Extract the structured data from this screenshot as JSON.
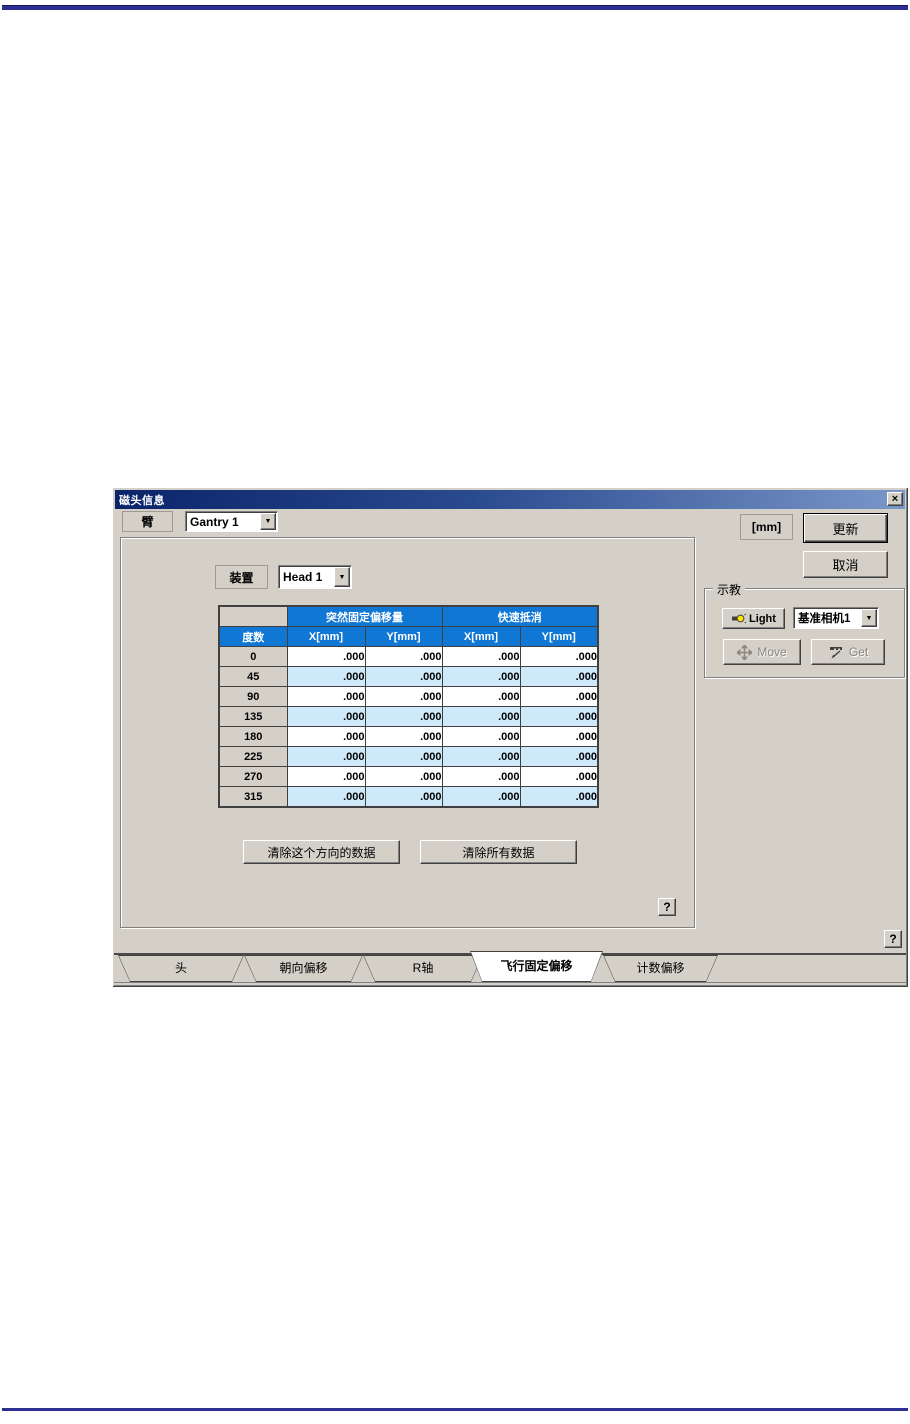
{
  "window": {
    "title": "磁头信息"
  },
  "icons": {
    "close": "×",
    "dropdown": "▼",
    "help": "?"
  },
  "arm": {
    "label": "臂",
    "value": "Gantry 1"
  },
  "toolbar": {
    "unit": "[mm]",
    "update": "更新",
    "cancel": "取消"
  },
  "device": {
    "label": "装置",
    "value": "Head 1"
  },
  "table": {
    "group_headers": [
      "突然固定偏移量",
      "快速抵消"
    ],
    "columns": [
      "度数",
      "X[mm]",
      "Y[mm]",
      "X[mm]",
      "Y[mm]"
    ],
    "rows": [
      {
        "deg": "0",
        "v": [
          ".000",
          ".000",
          ".000",
          ".000"
        ]
      },
      {
        "deg": "45",
        "v": [
          ".000",
          ".000",
          ".000",
          ".000"
        ]
      },
      {
        "deg": "90",
        "v": [
          ".000",
          ".000",
          ".000",
          ".000"
        ]
      },
      {
        "deg": "135",
        "v": [
          ".000",
          ".000",
          ".000",
          ".000"
        ]
      },
      {
        "deg": "180",
        "v": [
          ".000",
          ".000",
          ".000",
          ".000"
        ]
      },
      {
        "deg": "225",
        "v": [
          ".000",
          ".000",
          ".000",
          ".000"
        ]
      },
      {
        "deg": "270",
        "v": [
          ".000",
          ".000",
          ".000",
          ".000"
        ]
      },
      {
        "deg": "315",
        "v": [
          ".000",
          ".000",
          ".000",
          ".000"
        ]
      }
    ]
  },
  "actions": {
    "clear_direction": "清除这个方向的数据",
    "clear_all": "清除所有数据"
  },
  "teach": {
    "title": "示教",
    "light": "Light",
    "camera": "基准相机1",
    "move": "Move",
    "get": "Get"
  },
  "tabs": [
    {
      "label": "头",
      "active": false
    },
    {
      "label": "朝向偏移",
      "active": false
    },
    {
      "label": "R轴",
      "active": false
    },
    {
      "label": "飞行固定偏移",
      "active": true
    },
    {
      "label": "计数偏移",
      "active": false
    }
  ],
  "colors": {
    "header_blue": "#1177d4",
    "row_alt": "#cee9fa",
    "title_from": "#0a246a",
    "title_to": "#7a97c9",
    "page_rule": "#2d2f92",
    "face": "#d4d0c8"
  }
}
